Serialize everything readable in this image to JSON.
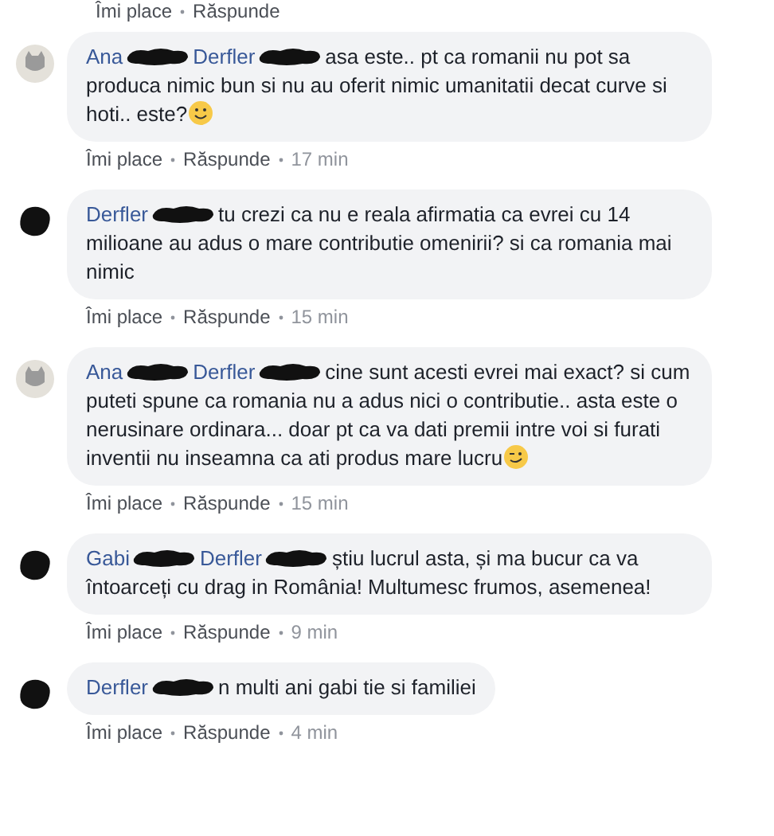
{
  "previous_actions": {
    "like": "Îmi place",
    "reply": "Răspunde"
  },
  "comments": [
    {
      "avatar": {
        "kind": "cat"
      },
      "author": "Ana",
      "mention": "Derfler",
      "text": "asa este.. pt ca romanii nu pot sa produca nimic bun si nu au oferit nimic umanitatii decat curve si hoti.. este?",
      "emoji": {
        "kind": "smile"
      },
      "like": "Îmi place",
      "reply": "Răspunde",
      "time": "17 min"
    },
    {
      "avatar": {
        "kind": "redacted"
      },
      "author": "Derfler",
      "text": "tu crezi ca nu e reala afirmatia ca evrei cu 14 milioane au adus o mare contributie omenirii? si ca romania mai nimic",
      "like": "Îmi place",
      "reply": "Răspunde",
      "time": "15 min"
    },
    {
      "avatar": {
        "kind": "cat"
      },
      "author": "Ana",
      "mention": "Derfler",
      "text": "cine sunt acesti evrei mai exact? si cum puteti spune ca romania nu a adus nici o contributie.. asta este o nerusinare ordinara... doar pt ca va dati premii intre voi si furati inventii nu inseamna ca ati produs mare lucru",
      "emoji": {
        "kind": "wink"
      },
      "like": "Îmi place",
      "reply": "Răspunde",
      "time": "15 min"
    },
    {
      "avatar": {
        "kind": "redacted"
      },
      "author": "Gabi",
      "mention": "Derfler",
      "text": "știu lucrul asta, și ma bucur ca va întoarceți cu drag in România! Multumesc frumos, asemenea!",
      "like": "Îmi place",
      "reply": "Răspunde",
      "time": "9 min"
    },
    {
      "avatar": {
        "kind": "redacted"
      },
      "author": "Derfler",
      "text": "n multi ani gabi tie si familiei",
      "like": "Îmi place",
      "reply": "Răspunde",
      "time": "4 min"
    }
  ]
}
